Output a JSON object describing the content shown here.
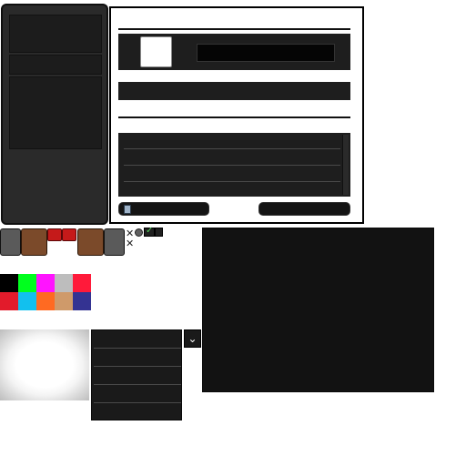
{
  "colors": {
    "panel_dark": "#1e1e1e",
    "panel_border": "#000000",
    "accent_green": "#52d35a"
  },
  "palette": [
    {
      "name": "black",
      "hex": "#000000"
    },
    {
      "name": "green",
      "hex": "#00ff1e"
    },
    {
      "name": "magenta",
      "hex": "#ff14ff"
    },
    {
      "name": "gray",
      "hex": "#bdbdbd"
    },
    {
      "name": "red",
      "hex": "#ff1a3a"
    },
    {
      "name": "crimson",
      "hex": "#e21b2b"
    },
    {
      "name": "cyan",
      "hex": "#12c0ee"
    },
    {
      "name": "orange",
      "hex": "#ff6a22"
    },
    {
      "name": "tan",
      "hex": "#cf9a6a"
    },
    {
      "name": "indigo",
      "hex": "#343392"
    }
  ],
  "icons": {
    "calculator": "calculator-icon",
    "close": "close-icon",
    "checkmark": "checkmark-icon",
    "chevron": "chevron-down-icon"
  },
  "glyphs": {
    "close": "✕",
    "check": "✓",
    "chevron": "⌄"
  }
}
